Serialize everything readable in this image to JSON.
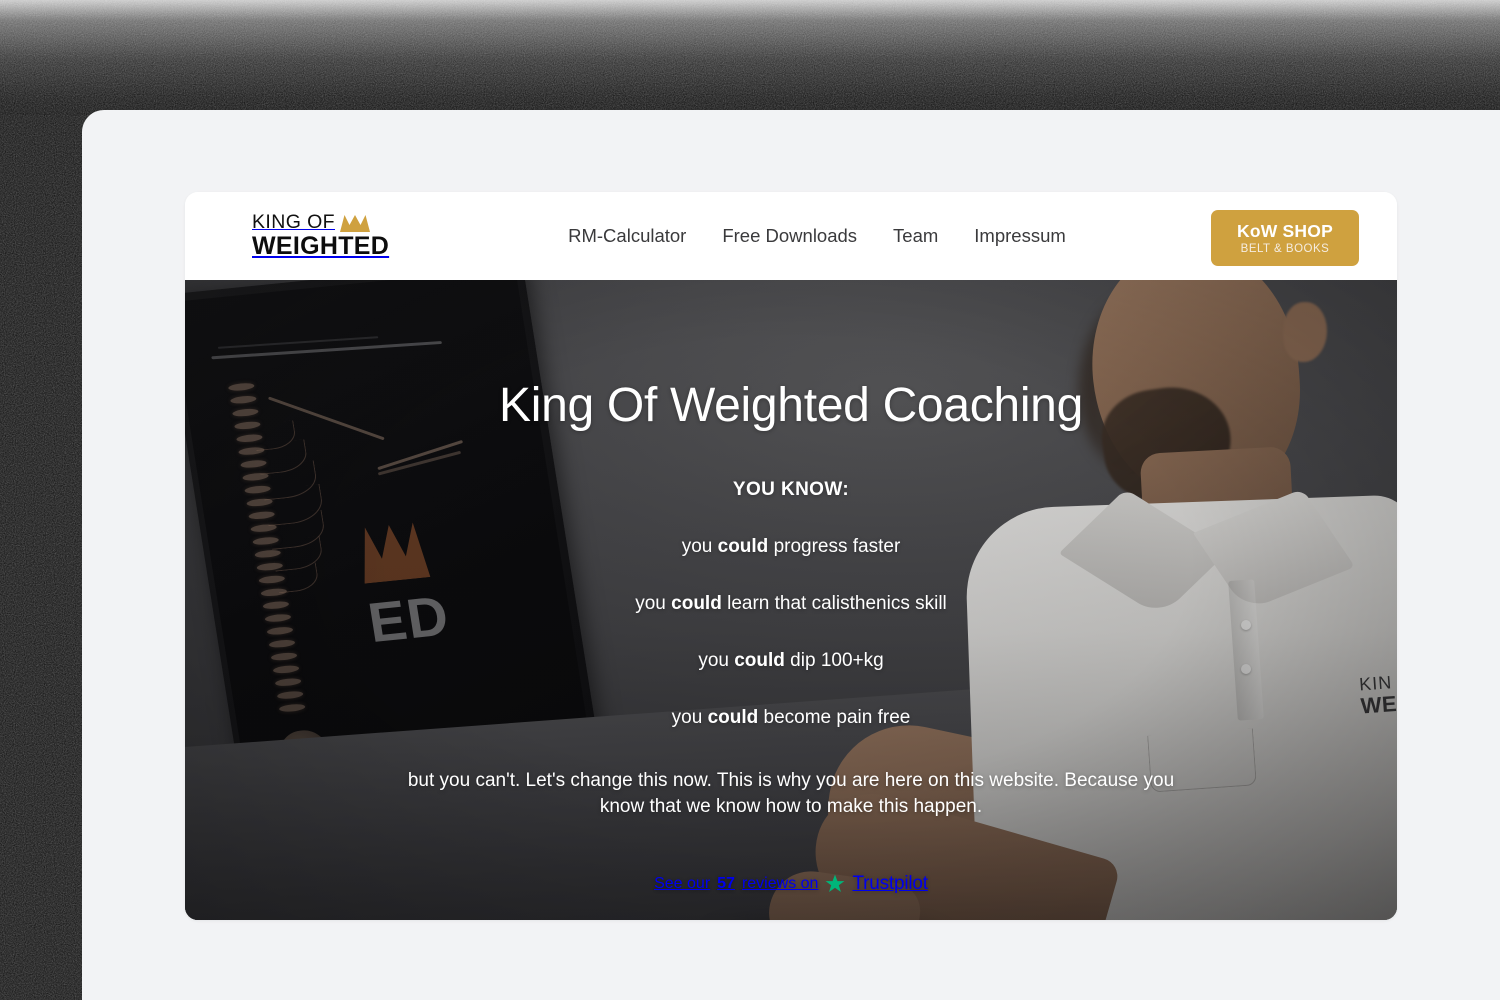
{
  "brand": {
    "logo_line1": "KING OF",
    "logo_line2": "WEIGHTED",
    "crown_icon": "crown-icon",
    "gold": "#cfa13f"
  },
  "header": {
    "nav": [
      {
        "label": "RM-Calculator"
      },
      {
        "label": "Free Downloads"
      },
      {
        "label": "Team"
      },
      {
        "label": "Impressum"
      }
    ],
    "shop_button": {
      "primary": "KoW SHOP",
      "secondary": "BELT & BOOKS"
    }
  },
  "hero": {
    "title": "King Of Weighted Coaching",
    "kicker": "YOU KNOW:",
    "bullets": [
      {
        "pre": "you ",
        "strong": "could",
        "post": " progress faster"
      },
      {
        "pre": "you ",
        "strong": "could",
        "post": " learn that calisthenics skill"
      },
      {
        "pre": "you ",
        "strong": "could",
        "post": " dip 100+kg"
      },
      {
        "pre": "you ",
        "strong": "could",
        "post": " become pain free"
      }
    ],
    "paragraph": "but you can't. Let's change this now. This is why you are here on this website. Because you know that we know how to make this happen.",
    "trustpilot": {
      "prefix": "See our ",
      "count": "57",
      "suffix": " reviews on",
      "name": "Trustpilot",
      "star_icon": "star-icon",
      "star_color": "#00b67a"
    },
    "photo": {
      "screen_text": "ED",
      "shirt_logo_line1": "KIN",
      "shirt_logo_line2": "WEI"
    }
  },
  "colors": {
    "page_background": "#f2f3f5",
    "card_background": "#ffffff",
    "nav_text": "#3a3a3c",
    "hero_overlay": "#4b4b4e"
  }
}
